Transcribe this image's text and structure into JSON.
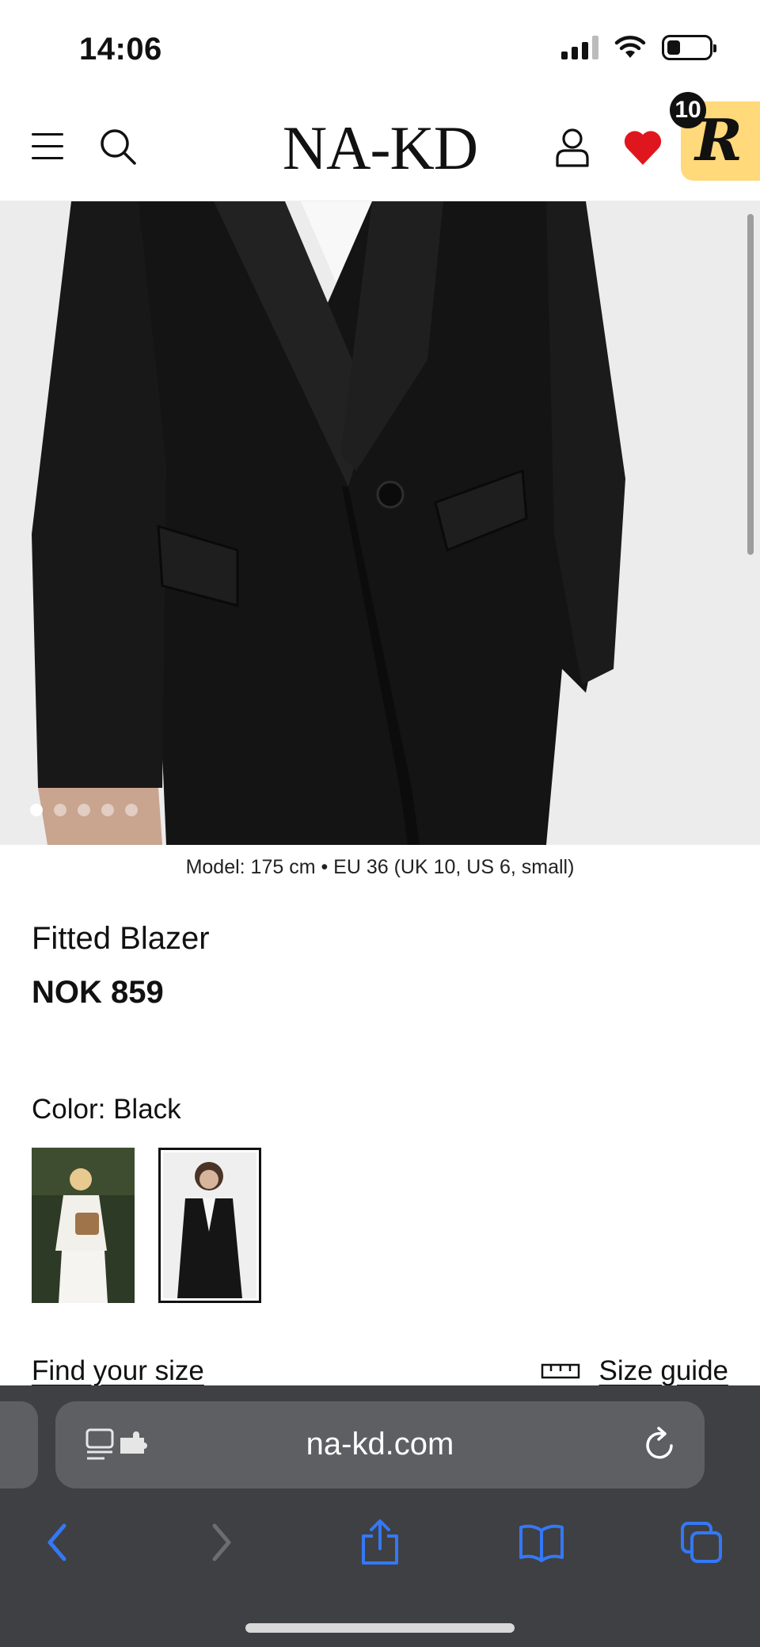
{
  "status_bar": {
    "time": "14:06"
  },
  "header": {
    "logo": "NA-KD",
    "rewards_count": "10",
    "rewards_letter": "R"
  },
  "product": {
    "model_info": "Model: 175 cm • EU 36 (UK 10, US 6, small)",
    "name": "Fitted Blazer",
    "price": "NOK 859",
    "color_label": "Color: Black",
    "carousel": {
      "total": 5,
      "active": 0
    },
    "color_swatches": [
      {
        "name": "White",
        "selected": false
      },
      {
        "name": "Black",
        "selected": true
      }
    ]
  },
  "size": {
    "find_size": "Find your size",
    "size_guide": "Size guide"
  },
  "browser": {
    "url": "na-kd.com"
  },
  "colors": {
    "accent_blue": "#3478f6",
    "wishlist_red": "#e0161e",
    "rewards_yellow": "#ffd97a",
    "browser_bar": "#3f4043"
  },
  "icons": [
    "hamburger-icon",
    "search-icon",
    "user-icon",
    "heart-icon",
    "ruler-icon",
    "reader-icon",
    "extension-icon",
    "reload-icon",
    "back-icon",
    "forward-icon",
    "share-icon",
    "bookmarks-icon",
    "tabs-icon"
  ]
}
